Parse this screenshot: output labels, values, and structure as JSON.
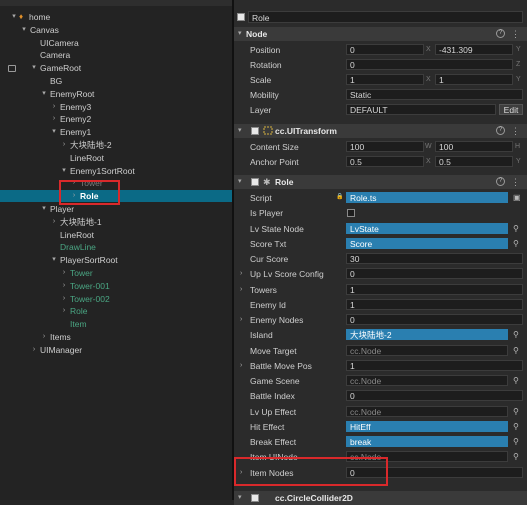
{
  "hierarchy": {
    "nodes": [
      {
        "label": "home",
        "depth": 0,
        "arrow": "down",
        "style": "normal"
      },
      {
        "label": "Canvas",
        "depth": 1,
        "arrow": "down",
        "style": "normal"
      },
      {
        "label": "UICamera",
        "depth": 2,
        "arrow": "",
        "style": "normal"
      },
      {
        "label": "Camera",
        "depth": 2,
        "arrow": "",
        "style": "normal"
      },
      {
        "label": "GameRoot",
        "depth": 2,
        "arrow": "down",
        "style": "normal"
      },
      {
        "label": "BG",
        "depth": 3,
        "arrow": "",
        "style": "normal"
      },
      {
        "label": "EnemyRoot",
        "depth": 3,
        "arrow": "down",
        "style": "normal"
      },
      {
        "label": "Enemy3",
        "depth": 4,
        "arrow": "right",
        "style": "normal"
      },
      {
        "label": "Enemy2",
        "depth": 4,
        "arrow": "right",
        "style": "normal"
      },
      {
        "label": "Enemy1",
        "depth": 4,
        "arrow": "down",
        "style": "normal"
      },
      {
        "label": "大块陆地-2",
        "depth": 5,
        "arrow": "right",
        "style": "normal"
      },
      {
        "label": "LineRoot",
        "depth": 5,
        "arrow": "",
        "style": "normal"
      },
      {
        "label": "Enemy1SortRoot",
        "depth": 5,
        "arrow": "down",
        "style": "normal"
      },
      {
        "label": "Tower",
        "depth": 6,
        "arrow": "right",
        "style": "dim"
      },
      {
        "label": "Role",
        "depth": 6,
        "arrow": "right",
        "style": "selected"
      },
      {
        "label": "Player",
        "depth": 3,
        "arrow": "down",
        "style": "normal"
      },
      {
        "label": "大块陆地-1",
        "depth": 4,
        "arrow": "right",
        "style": "normal"
      },
      {
        "label": "LineRoot",
        "depth": 4,
        "arrow": "",
        "style": "normal"
      },
      {
        "label": "DrawLine",
        "depth": 4,
        "arrow": "",
        "style": "green"
      },
      {
        "label": "PlayerSortRoot",
        "depth": 4,
        "arrow": "down",
        "style": "normal"
      },
      {
        "label": "Tower",
        "depth": 5,
        "arrow": "right",
        "style": "green"
      },
      {
        "label": "Tower-001",
        "depth": 5,
        "arrow": "right",
        "style": "green"
      },
      {
        "label": "Tower-002",
        "depth": 5,
        "arrow": "right",
        "style": "green"
      },
      {
        "label": "Role",
        "depth": 5,
        "arrow": "right",
        "style": "green"
      },
      {
        "label": "Item",
        "depth": 5,
        "arrow": "",
        "style": "green"
      },
      {
        "label": "Items",
        "depth": 3,
        "arrow": "right",
        "style": "normal"
      },
      {
        "label": "UIManager",
        "depth": 2,
        "arrow": "right",
        "style": "normal"
      }
    ]
  },
  "inspector": {
    "node_name": "Role",
    "sections": {
      "node": "Node",
      "uitransform": "cc.UITransform",
      "role": "Role",
      "circle": "cc.CircleCollider2D"
    },
    "node_props": {
      "position_label": "Position",
      "position_x": "0",
      "position_y": "-431.309",
      "rotation_label": "Rotation",
      "rotation_z": "0",
      "scale_label": "Scale",
      "scale_x": "1",
      "scale_y": "1",
      "mobility_label": "Mobility",
      "mobility_value": "Static",
      "layer_label": "Layer",
      "layer_value": "DEFAULT",
      "edit_label": "Edit"
    },
    "transform_props": {
      "content_size_label": "Content Size",
      "w": "100",
      "h": "100",
      "anchor_label": "Anchor Point",
      "ax": "0.5",
      "ay": "0.5"
    },
    "axis_labels": {
      "x": "X",
      "y": "Y",
      "z": "Z",
      "w": "W",
      "h": "H"
    },
    "role_props": [
      {
        "label": "Script",
        "value": "Role.ts",
        "kind": "ref",
        "arrow": false
      },
      {
        "label": "Is Player",
        "value": "",
        "kind": "checkbox",
        "arrow": false
      },
      {
        "label": "Lv State Node",
        "value": "LvState",
        "kind": "ref",
        "arrow": false
      },
      {
        "label": "Score Txt",
        "value": "Score",
        "kind": "ref",
        "arrow": false
      },
      {
        "label": "Cur Score",
        "value": "30",
        "kind": "num",
        "arrow": false
      },
      {
        "label": "Up Lv Score Config",
        "value": "0",
        "kind": "num",
        "arrow": true
      },
      {
        "label": "Towers",
        "value": "1",
        "kind": "num",
        "arrow": true
      },
      {
        "label": "Enemy Id",
        "value": "1",
        "kind": "num",
        "arrow": false
      },
      {
        "label": "Enemy Nodes",
        "value": "0",
        "kind": "num",
        "arrow": true
      },
      {
        "label": "Island",
        "value": "大块陆地-2",
        "kind": "ref",
        "arrow": false
      },
      {
        "label": "Move Target",
        "value": "cc.Node",
        "kind": "empty",
        "arrow": false
      },
      {
        "label": "Battle Move Pos",
        "value": "1",
        "kind": "num",
        "arrow": true
      },
      {
        "label": "Game Scene",
        "value": "cc.Node",
        "kind": "empty",
        "arrow": false
      },
      {
        "label": "Battle Index",
        "value": "0",
        "kind": "num",
        "arrow": false
      },
      {
        "label": "Lv Up Effect",
        "value": "cc.Node",
        "kind": "empty",
        "arrow": false
      },
      {
        "label": "Hit Effect",
        "value": "HitEff",
        "kind": "ref",
        "arrow": false
      },
      {
        "label": "Break Effect",
        "value": "break",
        "kind": "ref",
        "arrow": false
      },
      {
        "label": "Item UINode",
        "value": "cc.Node",
        "kind": "empty",
        "arrow": false
      },
      {
        "label": "Item Nodes",
        "value": "0",
        "kind": "num",
        "arrow": true
      }
    ]
  },
  "colors": {
    "selection": "#0b6a86",
    "highlight": "#d9292b",
    "prefab": "#4aa683",
    "ref": "#2a7fb0"
  }
}
